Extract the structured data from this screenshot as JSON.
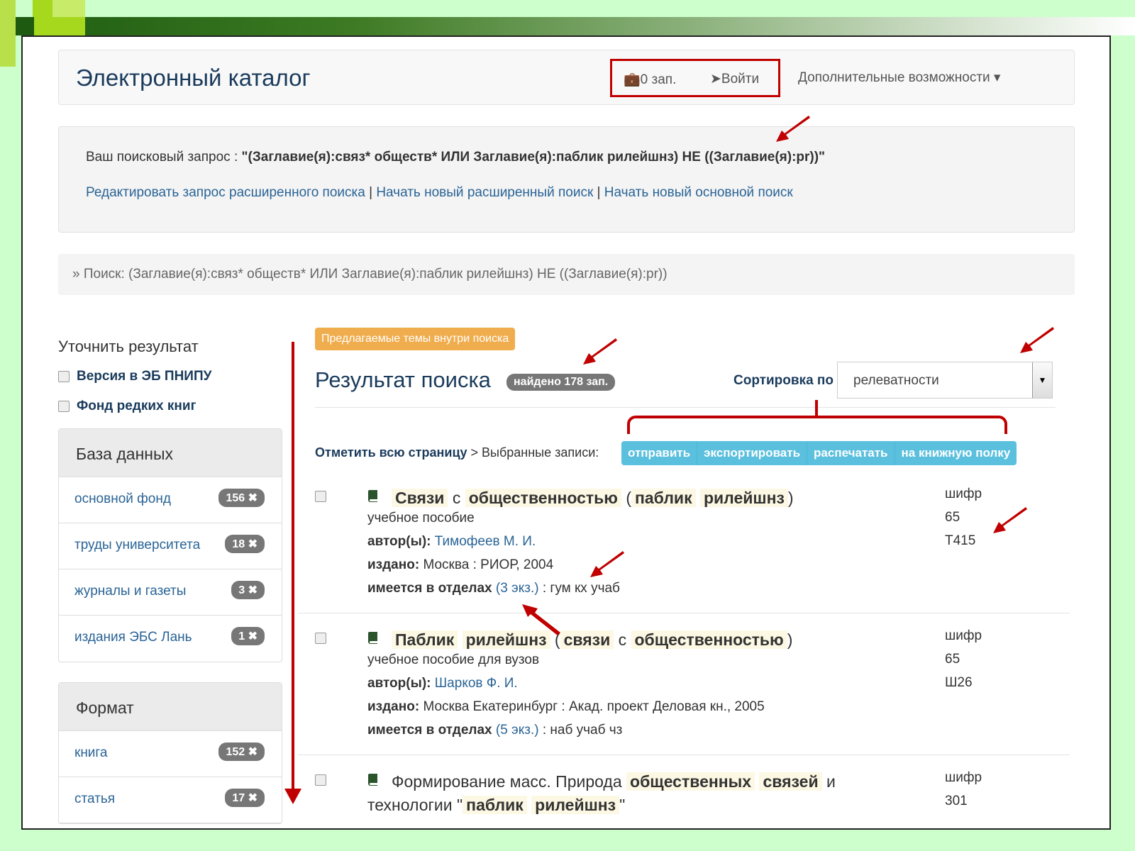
{
  "header": {
    "title": "Электронный каталог",
    "cart": "0 зап.",
    "login": "Войти",
    "more": "Дополнительные возможности"
  },
  "query": {
    "prefix": "Ваш поисковый запрос : ",
    "text": "\"(Заглавие(я):связ* обществ* ИЛИ Заглавие(я):паблик рилейшнз) НЕ ((Заглавие(я):pr))\"",
    "link_edit": "Редактировать запрос расширенного поиска",
    "link_new_adv": "Начать новый расширенный поиск",
    "link_new_basic": "Начать новый основной поиск",
    "separator": "|"
  },
  "breadcrumb": "»  Поиск: (Заглавие(я):связ* обществ* ИЛИ Заглавие(я):паблик рилейшнз) НЕ ((Заглавие(я):pr))",
  "sidebar": {
    "refine_title": "Уточнить результат",
    "checks": [
      "Версия в ЭБ ПНИПУ",
      "Фонд редких книг"
    ],
    "db_title": "База данных",
    "db_items": [
      {
        "label": "основной фонд",
        "count": "156 ✖"
      },
      {
        "label": "труды университета",
        "count": "18 ✖"
      },
      {
        "label": "журналы и газеты",
        "count": "3 ✖"
      },
      {
        "label": "издания ЭБС Лань",
        "count": "1 ✖"
      }
    ],
    "format_title": "Формат",
    "format_items": [
      {
        "label": "книга",
        "count": "152 ✖"
      },
      {
        "label": "статья",
        "count": "17 ✖"
      }
    ]
  },
  "main": {
    "topics_label": "Предлагаемые темы внутри поиска",
    "results_title": "Результат поиска",
    "found": "найдено 178 зап.",
    "sort_label": "Сортировка по",
    "sort_value": "релеватности",
    "mark_all": "Отметить всю страницу",
    "selected_label": " > Выбранные записи:",
    "actions": [
      "отправить",
      "экспортировать",
      "распечатать",
      "на книжную полку"
    ]
  },
  "records": [
    {
      "title_parts": [
        [
          "Связи",
          true
        ],
        [
          "с",
          false
        ],
        [
          "общественностью",
          true
        ],
        [
          "(",
          false
        ],
        [
          "паблик",
          true
        ],
        [
          "рилейшнз",
          true
        ],
        [
          ")",
          false
        ]
      ],
      "type": "учебное пособие",
      "author_label": "автор(ы):",
      "author": "Тимофеев М. И.",
      "pub_label": "издано:",
      "pub": "Москва : РИОР, 2004",
      "avail_label": "имеется в отделах",
      "avail_count": "(3 экз.)",
      "avail_depts": ": гум кх учаб",
      "code_label": "шифр",
      "code1": "65",
      "code2": "Т415"
    },
    {
      "title_parts": [
        [
          "Паблик",
          true
        ],
        [
          "рилейшнз",
          true
        ],
        [
          "(",
          false
        ],
        [
          "связи",
          true
        ],
        [
          "с",
          false
        ],
        [
          "общественностью",
          true
        ],
        [
          ")",
          false
        ]
      ],
      "type": "учебное пособие для вузов",
      "author_label": "автор(ы):",
      "author": "Шарков Ф. И.",
      "pub_label": "издано:",
      "pub": "Москва Екатеринбург : Акад. проект Деловая кн., 2005",
      "avail_label": "имеется в отделах",
      "avail_count": "(5 экз.)",
      "avail_depts": ": наб учаб чз",
      "code_label": "шифр",
      "code1": "65",
      "code2": "Ш26"
    },
    {
      "title_line1_a": "Формирование масс. Природа",
      "title_line1_b": "общественных",
      "title_line1_c": "связей",
      "title_line1_d": "и",
      "title_line2_a": "технологии \"",
      "title_line2_b": "паблик",
      "title_line2_c": "рилейшнз",
      "title_line2_d": "\"",
      "code_label": "шифр",
      "code1": "301"
    }
  ],
  "colors": {
    "annotation_red": "#c00000",
    "link_blue": "#2a6496",
    "info_button": "#5bc0de",
    "warning_badge": "#f0ad4e",
    "slide_bg": "#ccffcc"
  }
}
